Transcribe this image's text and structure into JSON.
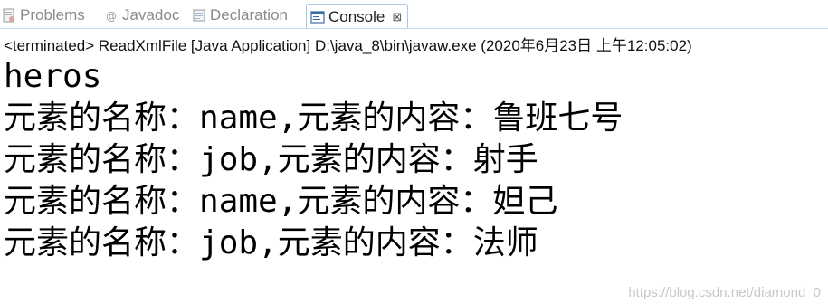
{
  "tabs": [
    {
      "label": "Problems",
      "icon": "problems-icon",
      "active": false
    },
    {
      "label": "Javadoc",
      "icon": "javadoc-at-icon",
      "active": false
    },
    {
      "label": "Declaration",
      "icon": "declaration-icon",
      "active": false
    },
    {
      "label": "Console",
      "icon": "console-icon",
      "active": true,
      "close_glyph": "⊠"
    }
  ],
  "status_line": "<terminated> ReadXmlFile [Java Application] D:\\java_8\\bin\\javaw.exe (2020年6月23日 上午12:05:02)",
  "output": [
    {
      "text": "heros"
    },
    {
      "prefix": "元素的名称：",
      "name": "name",
      "sep": ",",
      "mid": "元素的内容：",
      "value": "鲁班七号"
    },
    {
      "prefix": "元素的名称：",
      "name": "job",
      "sep": ",",
      "mid": "元素的内容：",
      "value": "射手"
    },
    {
      "prefix": "元素的名称：",
      "name": "name",
      "sep": ",",
      "mid": "元素的内容：",
      "value": "妲己"
    },
    {
      "prefix": "元素的名称：",
      "name": "job",
      "sep": ",",
      "mid": "元素的内容：",
      "value": "法师"
    }
  ],
  "watermark": "https://blog.csdn.net/diamond_0",
  "colors": {
    "active_tab_border": "#a9c7e8",
    "inactive_tab_text": "#8a8a8a",
    "console_text": "#000000"
  }
}
